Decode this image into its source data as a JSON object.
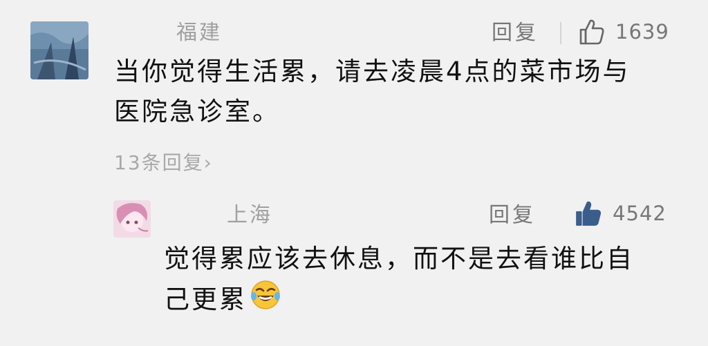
{
  "comments": [
    {
      "location": "福建",
      "reply_label": "回复",
      "likes": "1639",
      "text_lines": [
        "当你觉得生活累，请去凌晨4点的菜市场与",
        "医院急诊室。"
      ],
      "replies_link": "13条回复",
      "avatar_icon": "blue-landscape-avatar",
      "like_icon": "thumbs-up-outline-icon"
    },
    {
      "location": "上海",
      "reply_label": "回复",
      "likes": "4542",
      "text_lines": [
        "觉得累应该去休息，而不是去看谁比自",
        "己更累"
      ],
      "avatar_icon": "pink-anime-avatar",
      "like_icon": "thumbs-up-filled-icon",
      "emoji": "laughing-crying-emoji"
    }
  ],
  "colors": {
    "background": "#f1f1f1",
    "text": "#111111",
    "meta": "#a0a0a0",
    "like_filled": "#3a5d8c"
  }
}
